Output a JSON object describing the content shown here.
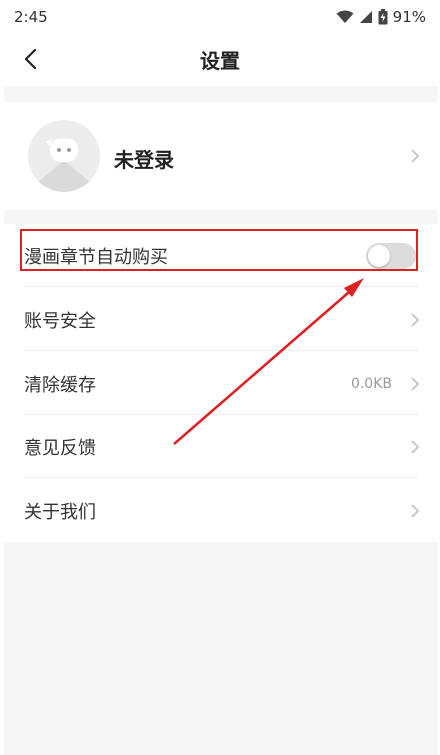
{
  "status": {
    "time": "2:45",
    "battery": "91%"
  },
  "nav": {
    "title": "设置"
  },
  "profile": {
    "name": "未登录"
  },
  "settings": {
    "auto_buy": {
      "label": "漫画章节自动购买",
      "enabled": false
    },
    "account_security": {
      "label": "账号安全"
    },
    "clear_cache": {
      "label": "清除缓存",
      "value": "0.0KB"
    },
    "feedback": {
      "label": "意见反馈"
    },
    "about": {
      "label": "关于我们"
    }
  },
  "colors": {
    "annotation": "#e02020",
    "toggle_off": "#dcdcdc",
    "background": "#f6f6f6"
  },
  "icons": [
    "back-arrow-icon",
    "wifi-icon",
    "signal-icon",
    "battery-icon",
    "chevron-right-icon"
  ]
}
